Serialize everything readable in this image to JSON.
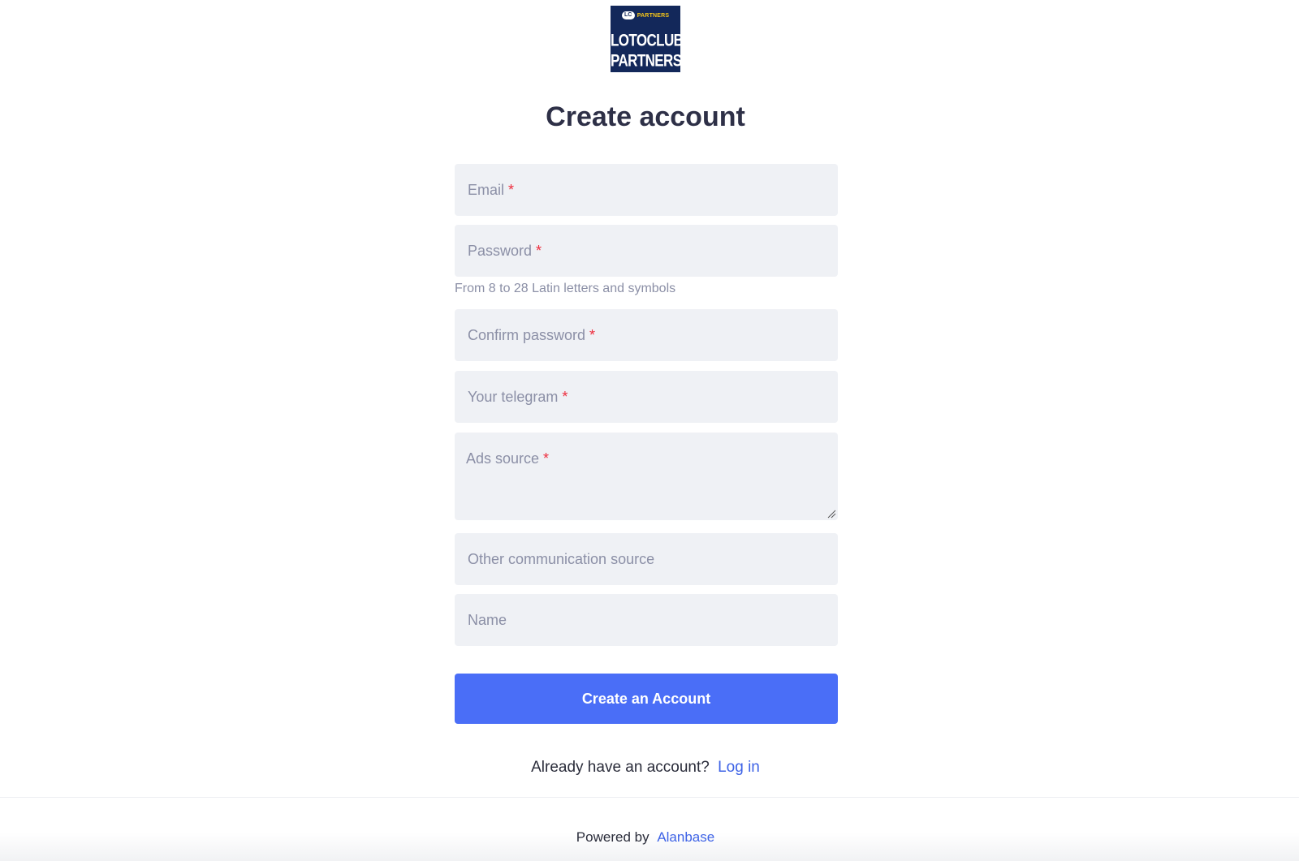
{
  "logo": {
    "badge": "LC",
    "small_text": "PARTNERS",
    "line1": "LOTOCLUB",
    "line2": "PARTNERS"
  },
  "title": "Create account",
  "form": {
    "email_placeholder": "Email",
    "password_placeholder": "Password",
    "password_hint": "From 8 to 28 Latin letters and symbols",
    "confirm_password_placeholder": "Confirm password",
    "telegram_placeholder": "Your telegram",
    "ads_source_placeholder": "Ads source",
    "other_source_placeholder": "Other communication source",
    "name_placeholder": "Name",
    "required_mark": "*",
    "submit_label": "Create an Account"
  },
  "login": {
    "prompt": "Already have an account?",
    "link_label": "Log in"
  },
  "footer": {
    "powered_by": "Powered by",
    "brand": "Alanbase"
  },
  "colors": {
    "accent": "#4a6ef7",
    "link": "#3e63e6",
    "required": "#ee2d3d",
    "field_bg": "#eff1f5",
    "logo_bg": "#13285a"
  }
}
